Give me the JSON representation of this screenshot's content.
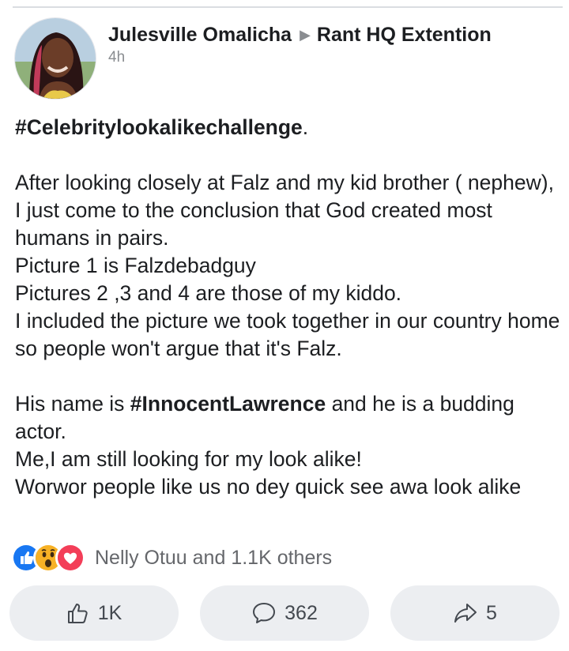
{
  "post": {
    "author": "Julesville Omalicha",
    "group": "Rant HQ Extention",
    "time": "4h",
    "hashtag_title": "#Celebritylookalikechallenge",
    "title_suffix": ".",
    "paragraph1": "After looking closely at Falz and my kid brother ( nephew), I just come to the conclusion that God created most humans in pairs.\nPicture 1 is Falzdebadguy\nPictures 2 ,3 and 4 are those of my kiddo.\nI included the picture we took together in our country home so people won't argue that it's Falz.",
    "p2_prefix": "His name is ",
    "p2_hashtag": "#InnocentLawrence",
    "p2_suffix": " and he is a budding actor.\nMe,I am still looking for my look alike!\nWorwor people like us no dey quick see awa look alike"
  },
  "reactions": {
    "icons": [
      "like-icon",
      "wow-icon",
      "love-icon"
    ],
    "summary": "Nelly Otuu and 1.1K others"
  },
  "actions": {
    "like_count": "1K",
    "comment_count": "362",
    "share_count": "5"
  },
  "colors": {
    "like": "#1877f2",
    "love": "#f33e58",
    "wow": "#f7b125",
    "button_bg": "#eceef1",
    "secondary_text": "#65676b"
  }
}
